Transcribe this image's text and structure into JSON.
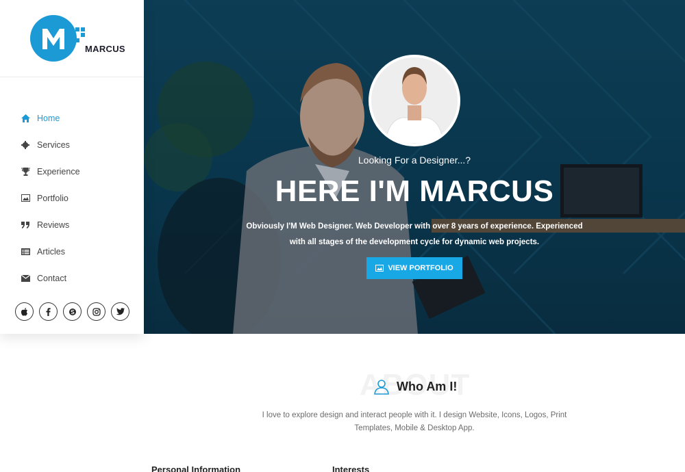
{
  "brand": {
    "name": "MARCUS",
    "color": "#1b9ad6"
  },
  "nav": [
    {
      "label": "Home",
      "icon": "home-icon",
      "active": true
    },
    {
      "label": "Services",
      "icon": "gear-icon"
    },
    {
      "label": "Experience",
      "icon": "trophy-icon"
    },
    {
      "label": "Portfolio",
      "icon": "image-icon"
    },
    {
      "label": "Reviews",
      "icon": "quote-icon"
    },
    {
      "label": "Articles",
      "icon": "list-icon"
    },
    {
      "label": "Contact",
      "icon": "envelope-icon"
    }
  ],
  "socials": [
    "apple-icon",
    "facebook-icon",
    "skype-icon",
    "instagram-icon",
    "twitter-icon"
  ],
  "hero": {
    "tagline": "Looking For a Designer...?",
    "headline": "HERE I'M MARCUS",
    "description": "Obviously I'M Web Designer. Web Developer with over 8 years of experience. Experienced with all stages of the development cycle for dynamic web projects.",
    "cta_label": "VIEW PORTFOLIO"
  },
  "about": {
    "bg_word": "ABOUT",
    "title": "Who Am I!",
    "text": "I love to explore design and interact people with it. I design Website, Icons, Logos, Print Templates, Mobile & Desktop App.",
    "personal_heading": "Personal Information",
    "interests_heading": "Interests"
  }
}
